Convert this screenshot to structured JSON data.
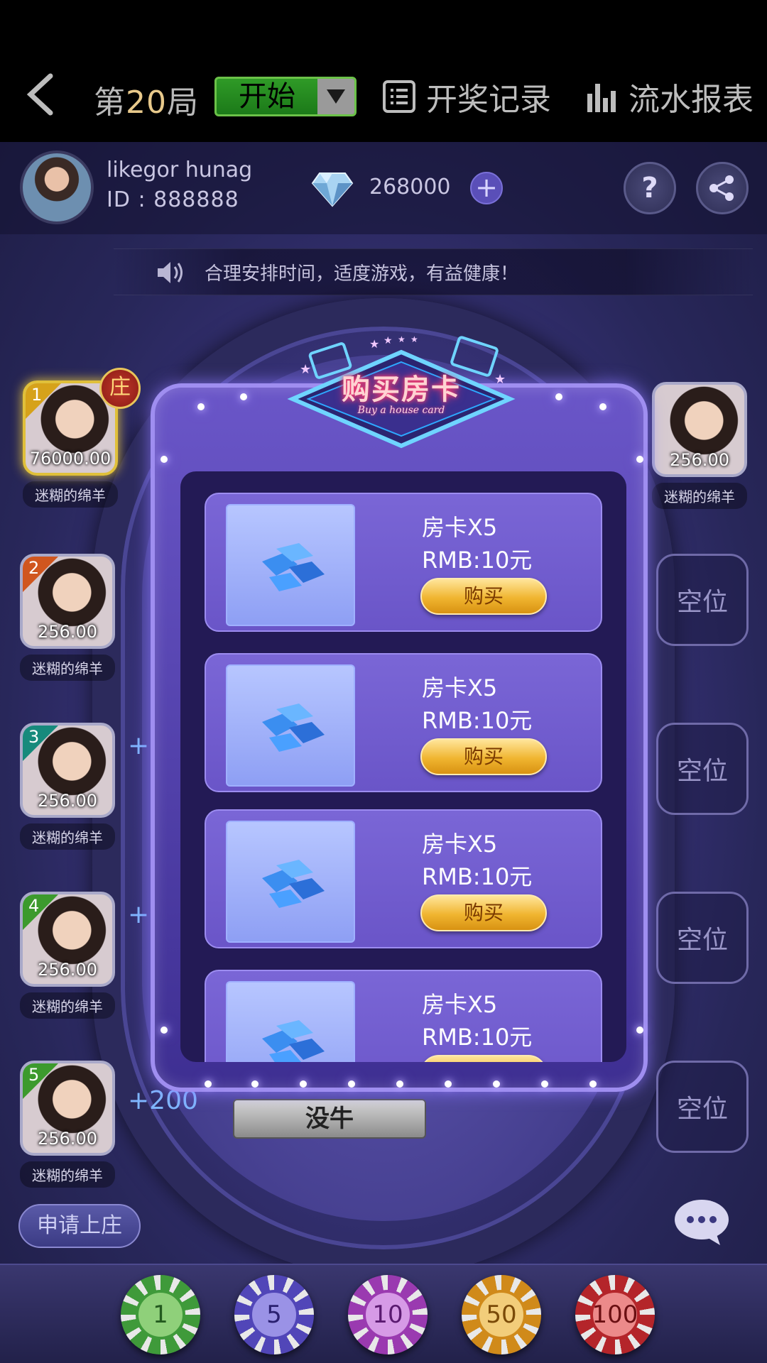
{
  "topbar": {
    "round_prefix": "第",
    "round_number": "20",
    "round_suffix": "局",
    "start_label": "开始",
    "records_label": "开奖记录",
    "flow_label": "流水报表"
  },
  "user": {
    "name": "likegor hunag",
    "id_text": "ID : 888888",
    "diamonds": "268000"
  },
  "notice": "合理安排时间，适度游戏，有益健康！",
  "banker_badge": "庄",
  "seats": [
    {
      "index": "1",
      "score": "76000.00",
      "nick": "迷糊的绵羊",
      "color": "#d6a21a"
    },
    {
      "index": "2",
      "score": "256.00",
      "nick": "迷糊的绵羊",
      "color": "#d0561f"
    },
    {
      "index": "3",
      "score": "256.00",
      "nick": "迷糊的绵羊",
      "color": "#178a7c"
    },
    {
      "index": "4",
      "score": "256.00",
      "nick": "迷糊的绵羊",
      "color": "#3c9a2d"
    },
    {
      "index": "5",
      "score": "256.00",
      "nick": "迷糊的绵羊",
      "color": "#3c9a2d"
    }
  ],
  "right_seat": {
    "score": "256.00",
    "nick": "迷糊的绵羊"
  },
  "empty_label": "空位",
  "bet_plus": "+",
  "bet_plus200": "+200",
  "cards_label": "没牛",
  "apply_label": "申请上庄",
  "chips": [
    {
      "value": "1",
      "color": "#3f9a3a"
    },
    {
      "value": "5",
      "color": "#5146b8"
    },
    {
      "value": "10",
      "color": "#9a3ab0"
    },
    {
      "value": "50",
      "color": "#d08a1a"
    },
    {
      "value": "100",
      "color": "#b4252a"
    }
  ],
  "modal": {
    "title": "购买房卡",
    "subtitle": "Buy a house card",
    "items": [
      {
        "name": "房卡X5",
        "price": "RMB:10元",
        "buy": "购买"
      },
      {
        "name": "房卡X5",
        "price": "RMB:10元",
        "buy": "购买"
      },
      {
        "name": "房卡X5",
        "price": "RMB:10元",
        "buy": "购买"
      },
      {
        "name": "房卡X5",
        "price": "RMB:10元",
        "buy": "购买"
      }
    ]
  }
}
